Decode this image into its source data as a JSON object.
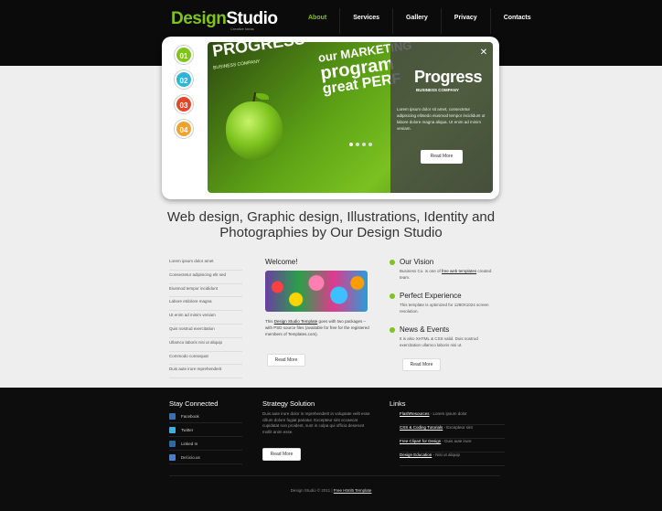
{
  "header": {
    "logo_part1": "Design",
    "logo_part2": "Studio",
    "tagline": "Creative Ideas",
    "nav": [
      "About",
      "Services",
      "Gallery",
      "Privacy",
      "Contacts"
    ],
    "active_nav": "About"
  },
  "slider": {
    "numbers": [
      "01",
      "02",
      "03",
      "04"
    ],
    "number_colors": [
      "#7fc41c",
      "#2bb5d8",
      "#e2472b",
      "#f0a32c"
    ],
    "image_text_big": "PROGRESS",
    "image_text_small": "BUSINESS COMPANY",
    "image_marketing_lines": [
      "our MARKETING",
      "program",
      "great PERF"
    ],
    "caption_title": "Progress",
    "caption_subtitle": "BUSINESS COMPANY",
    "caption_text": "Lorem ipsum dolor sit amet, consectetur adipisicing elitsedo eiusmod tempor incididunt ut labore dolore magna aliqua. Ut enim ad minim veniam.",
    "caption_button": "Read More",
    "close_symbol": "✕"
  },
  "headline": "Web design, Graphic design, Illustrations, Identity and Photographies by Our Design Studio",
  "sidelist": [
    "Lorem ipsum dolor amet",
    "Consectetur adipisicing elit sed",
    "Eiusmod tempor incididunt",
    "Labore etdolore magna",
    "Ut enim ad minim veniam",
    "Quis nostrud exercitation",
    "Ullamco laboris nisi ut aliquip",
    "Commodo consequat",
    "Duis aute irure reprehenderit"
  ],
  "welcome": {
    "title": "Welcome!",
    "text_before": "This",
    "link": "Design Studio Template",
    "text_after": "goes with two packages – with PSD source files (available for free for the registered members of Templates.com).",
    "button": "Read More"
  },
  "right": {
    "vision_title": "Our Vision",
    "vision_text_before": "Business Co. is one of",
    "vision_link": "free web templates",
    "vision_text_after": "created team.",
    "exp_title": "Perfect Experience",
    "exp_text": "This template is optimized for 1280X1024 screen resolution.",
    "news_title": "News & Events",
    "news_text": "It is also XHTML & CSS valid. Duis nostrud exercitation ullamco laboris nisi ut.",
    "button": "Read More"
  },
  "footer": {
    "stay_title": "Stay Connected",
    "stay_items": [
      "Facebook",
      "Twitter",
      "Linked In",
      "Del.icio.us"
    ],
    "strategy_title": "Strategy Solution",
    "strategy_text": "Duis aute irure dolor in reprehenderit in voluptate velit esse cillum dolore fugiat pariatur. Excepteur sint occaecat cupidatat non proident, sunt in culpa qui officia deserunt mollit anim esse.",
    "strategy_button": "Read More",
    "links_title": "Links",
    "links": [
      {
        "link": "FlashResources",
        "text": " - Lorem ipsum dolor"
      },
      {
        "link": "CSS & Coding Tutorials",
        "text": " - Excepteur sint"
      },
      {
        "link": "Free Clipart for Design",
        "text": " - Duis aute irure"
      },
      {
        "link": "Design Education",
        "text": " - Nisi ut aliquip"
      }
    ],
    "copyright_before": "Design Studio © 2011",
    "copyright_link": "Free Html5 Template"
  }
}
